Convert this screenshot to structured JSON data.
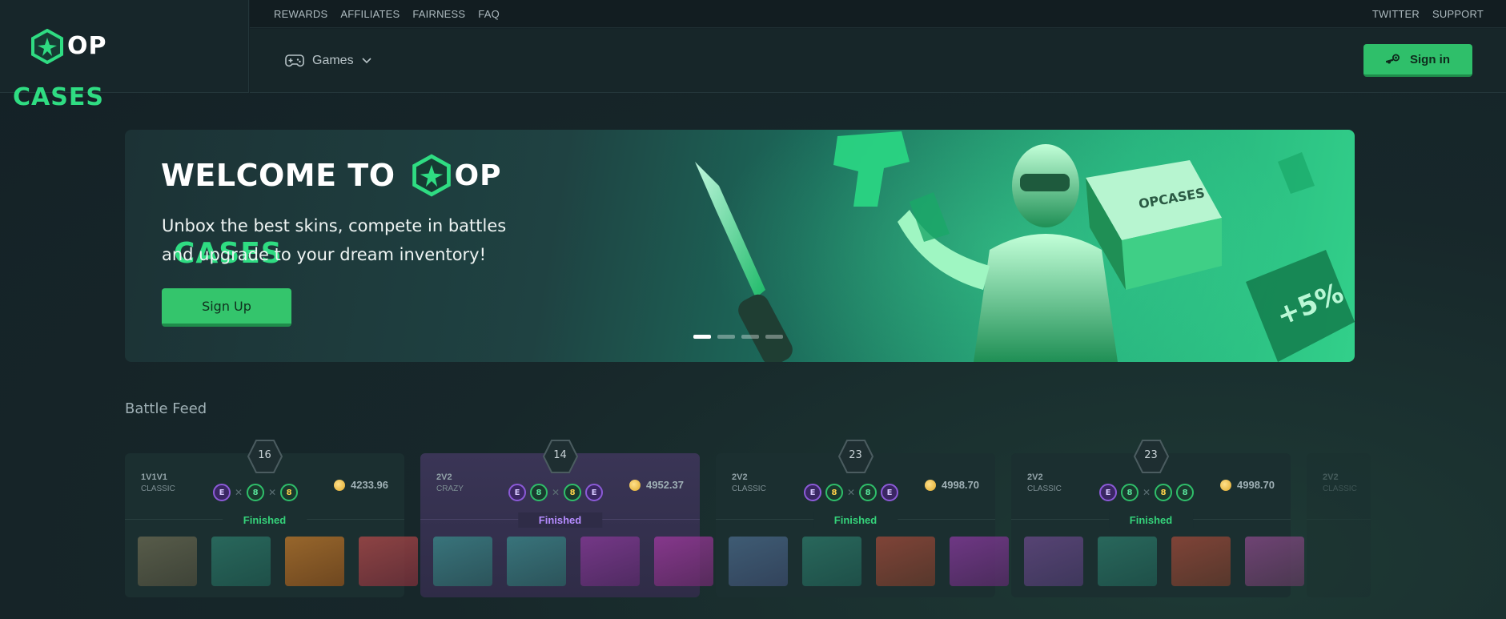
{
  "brand": {
    "name_part1": "OP",
    "name_part2": "CASES",
    "accent": "#2fdc82"
  },
  "topbar": {
    "left_links": [
      "REWARDS",
      "AFFILIATES",
      "FAIRNESS",
      "FAQ"
    ],
    "right_links": [
      "TWITTER",
      "SUPPORT"
    ]
  },
  "navbar": {
    "games_label": "Games",
    "signin_label": "Sign in"
  },
  "hero": {
    "welcome": "WELCOME TO",
    "subtitle": "Unbox the best skins, compete in battles and upgrade to your dream inventory!",
    "signup_label": "Sign Up",
    "slides": 4,
    "active_slide": 0
  },
  "battle_feed": {
    "title": "Battle Feed",
    "cards": [
      {
        "rounds": "16",
        "mode": "1V1V1",
        "type": "CLASSIC",
        "price": "4233.96",
        "status": "Finished",
        "players": [
          "purple",
          "vs",
          "green",
          "vs",
          "yellow"
        ]
      },
      {
        "rounds": "14",
        "mode": "2V2",
        "type": "CRAZY",
        "price": "4952.37",
        "status": "Finished",
        "players": [
          "purple",
          "green",
          "vs",
          "yellow",
          "purple"
        ]
      },
      {
        "rounds": "23",
        "mode": "2V2",
        "type": "CLASSIC",
        "price": "4998.70",
        "status": "Finished",
        "players": [
          "purple",
          "yellow",
          "vs",
          "green",
          "purple"
        ]
      },
      {
        "rounds": "23",
        "mode": "2V2",
        "type": "CLASSIC",
        "price": "4998.70",
        "status": "Finished",
        "players": [
          "purple",
          "green",
          "vs",
          "yellow",
          "green"
        ]
      },
      {
        "rounds": "",
        "mode": "2V2",
        "type": "CLASSIC",
        "price": "",
        "status": "",
        "players": []
      }
    ]
  },
  "colors": {
    "bg": "#17272a",
    "button_green": "#2fbf6a",
    "status_green": "#35d27a",
    "crazy_purple": "#b58cff"
  }
}
